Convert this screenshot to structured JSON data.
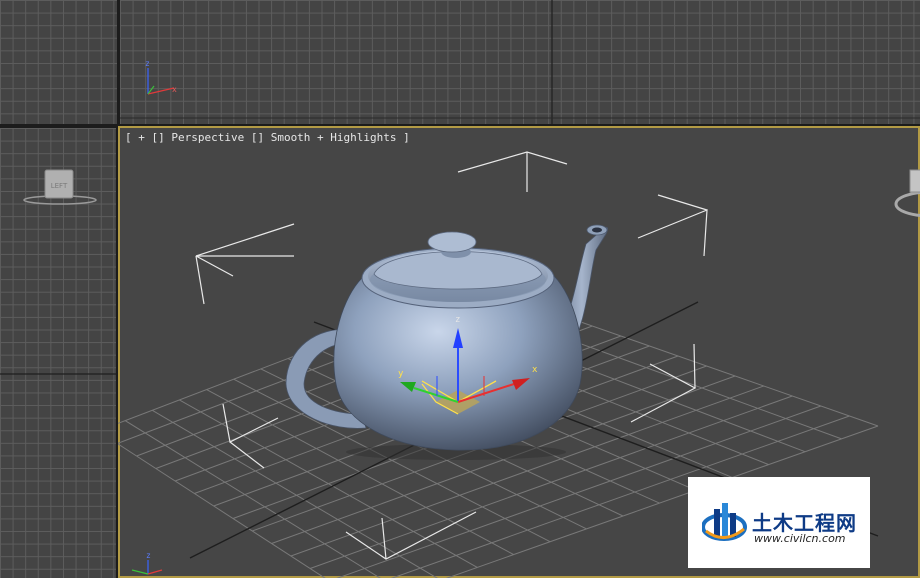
{
  "viewport_label": "[ + [] Perspective [] Smooth + Highlights ]",
  "view_cube_left": "LEFT",
  "axes": {
    "x": "x",
    "y": "y",
    "z": "z"
  },
  "watermark": {
    "cn": "土木工程网",
    "url": "www.civilcn.com"
  },
  "colors": {
    "active_border": "#b39b45",
    "grid": "#5d5d5d",
    "teapot": "#7f93b0"
  }
}
